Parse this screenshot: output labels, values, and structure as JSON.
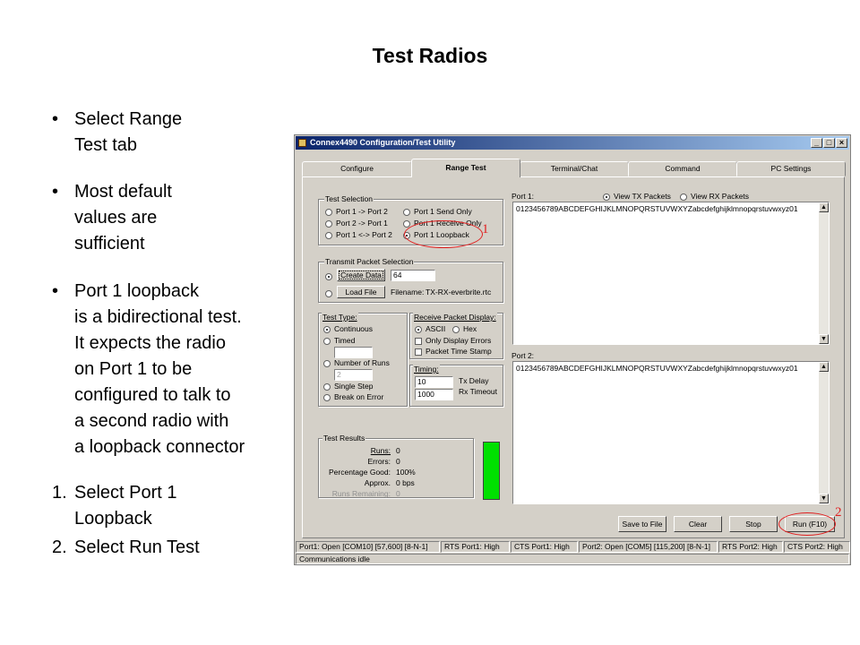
{
  "slide": {
    "title": "Test Radios",
    "bullets": [
      {
        "marker": "•",
        "lines": [
          "Select Range",
          "Test tab"
        ]
      },
      {
        "marker": "•",
        "lines": [
          "Most default",
          "values are",
          "sufficient"
        ]
      },
      {
        "marker": "•",
        "lines": [
          "Port 1 loopback",
          "is a bidirectional test.",
          "It expects the radio",
          "on Port 1 to be",
          "configured to talk to",
          "a second radio with",
          "a loopback connector"
        ]
      },
      {
        "marker": "1.",
        "lines": [
          "Select Port 1",
          "Loopback"
        ]
      },
      {
        "marker": "2.",
        "lines": [
          "Select Run Test"
        ]
      }
    ]
  },
  "window": {
    "title": "Connex4490 Configuration/Test Utility",
    "controls": {
      "minimize": "_",
      "maximize": "□",
      "close": "×"
    },
    "tabs": [
      "Configure",
      "Range Test",
      "Terminal/Chat",
      "Command",
      "PC Settings"
    ],
    "active_tab": "Range Test",
    "test_selection": {
      "label": "Test Selection",
      "options": [
        "Port 1 -> Port 2",
        "Port 2 -> Port 1",
        "Port 1 <-> Port 2",
        "Port 1 Send Only",
        "Port 1 Receive Only",
        "Port 1 Loopback"
      ],
      "selected": "Port 1 Loopback"
    },
    "transmit": {
      "label": "Transmit Packet Selection",
      "create_data_label": "Create Data",
      "size_value": "64",
      "load_file_label": "Load File",
      "filename_label": "Filename:",
      "filename_value": "TX-RX-everbrite.rtc"
    },
    "test_type": {
      "label": "Test Type:",
      "continuous": "Continuous",
      "timed": "Timed",
      "timed_value": "",
      "number_of_runs": "Number of Runs",
      "runs_value": "2",
      "single_step": "Single Step",
      "break_on_error": "Break on Error"
    },
    "receive_display": {
      "label": "Receive Packet Display:",
      "ascii": "ASCII",
      "hex": "Hex",
      "only_errors": "Only Display Errors",
      "time_stamp": "Packet Time Stamp"
    },
    "timing": {
      "label": "Timing:",
      "tx_delay_value": "10",
      "tx_delay_label": "Tx Delay",
      "rx_timeout_value": "1000",
      "rx_timeout_label": "Rx Timeout"
    },
    "results": {
      "label": "Test Results",
      "rows": [
        {
          "label": "Runs:",
          "value": "0"
        },
        {
          "label": "Errors:",
          "value": "0"
        },
        {
          "label": "Percentage Good:",
          "value": "100%"
        },
        {
          "label": "Approx.",
          "value": "0 bps"
        },
        {
          "label": "Runs Remaining:",
          "value": "0"
        }
      ],
      "indicator_color": "#00e000"
    },
    "port1": {
      "label": "Port 1:",
      "view_tx": "View TX Packets",
      "view_rx": "View RX Packets",
      "text": "0123456789ABCDEFGHIJKLMNOPQRSTUVWXYZabcdefghijklmnopqrstuvwxyz01"
    },
    "port2": {
      "label": "Port 2:",
      "text": "0123456789ABCDEFGHIJKLMNOPQRSTUVWXYZabcdefghijklmnopqrstuvwxyz01"
    },
    "buttons": {
      "save_to_file": "Save to File",
      "clear": "Clear",
      "stop": "Stop",
      "run": "Run (F10)"
    },
    "statusbar": [
      "Port1: Open  [COM10] [57,600] [8-N-1]",
      "RTS Port1: High",
      "CTS Port1: High",
      "Port2: Open  [COM5] [115,200] [8-N-1]",
      "RTS Port2: High",
      "CTS Port2: High"
    ],
    "status_message": "Communications idle"
  },
  "annotations": {
    "one": "1",
    "two": "2",
    "color": "#e02020"
  }
}
